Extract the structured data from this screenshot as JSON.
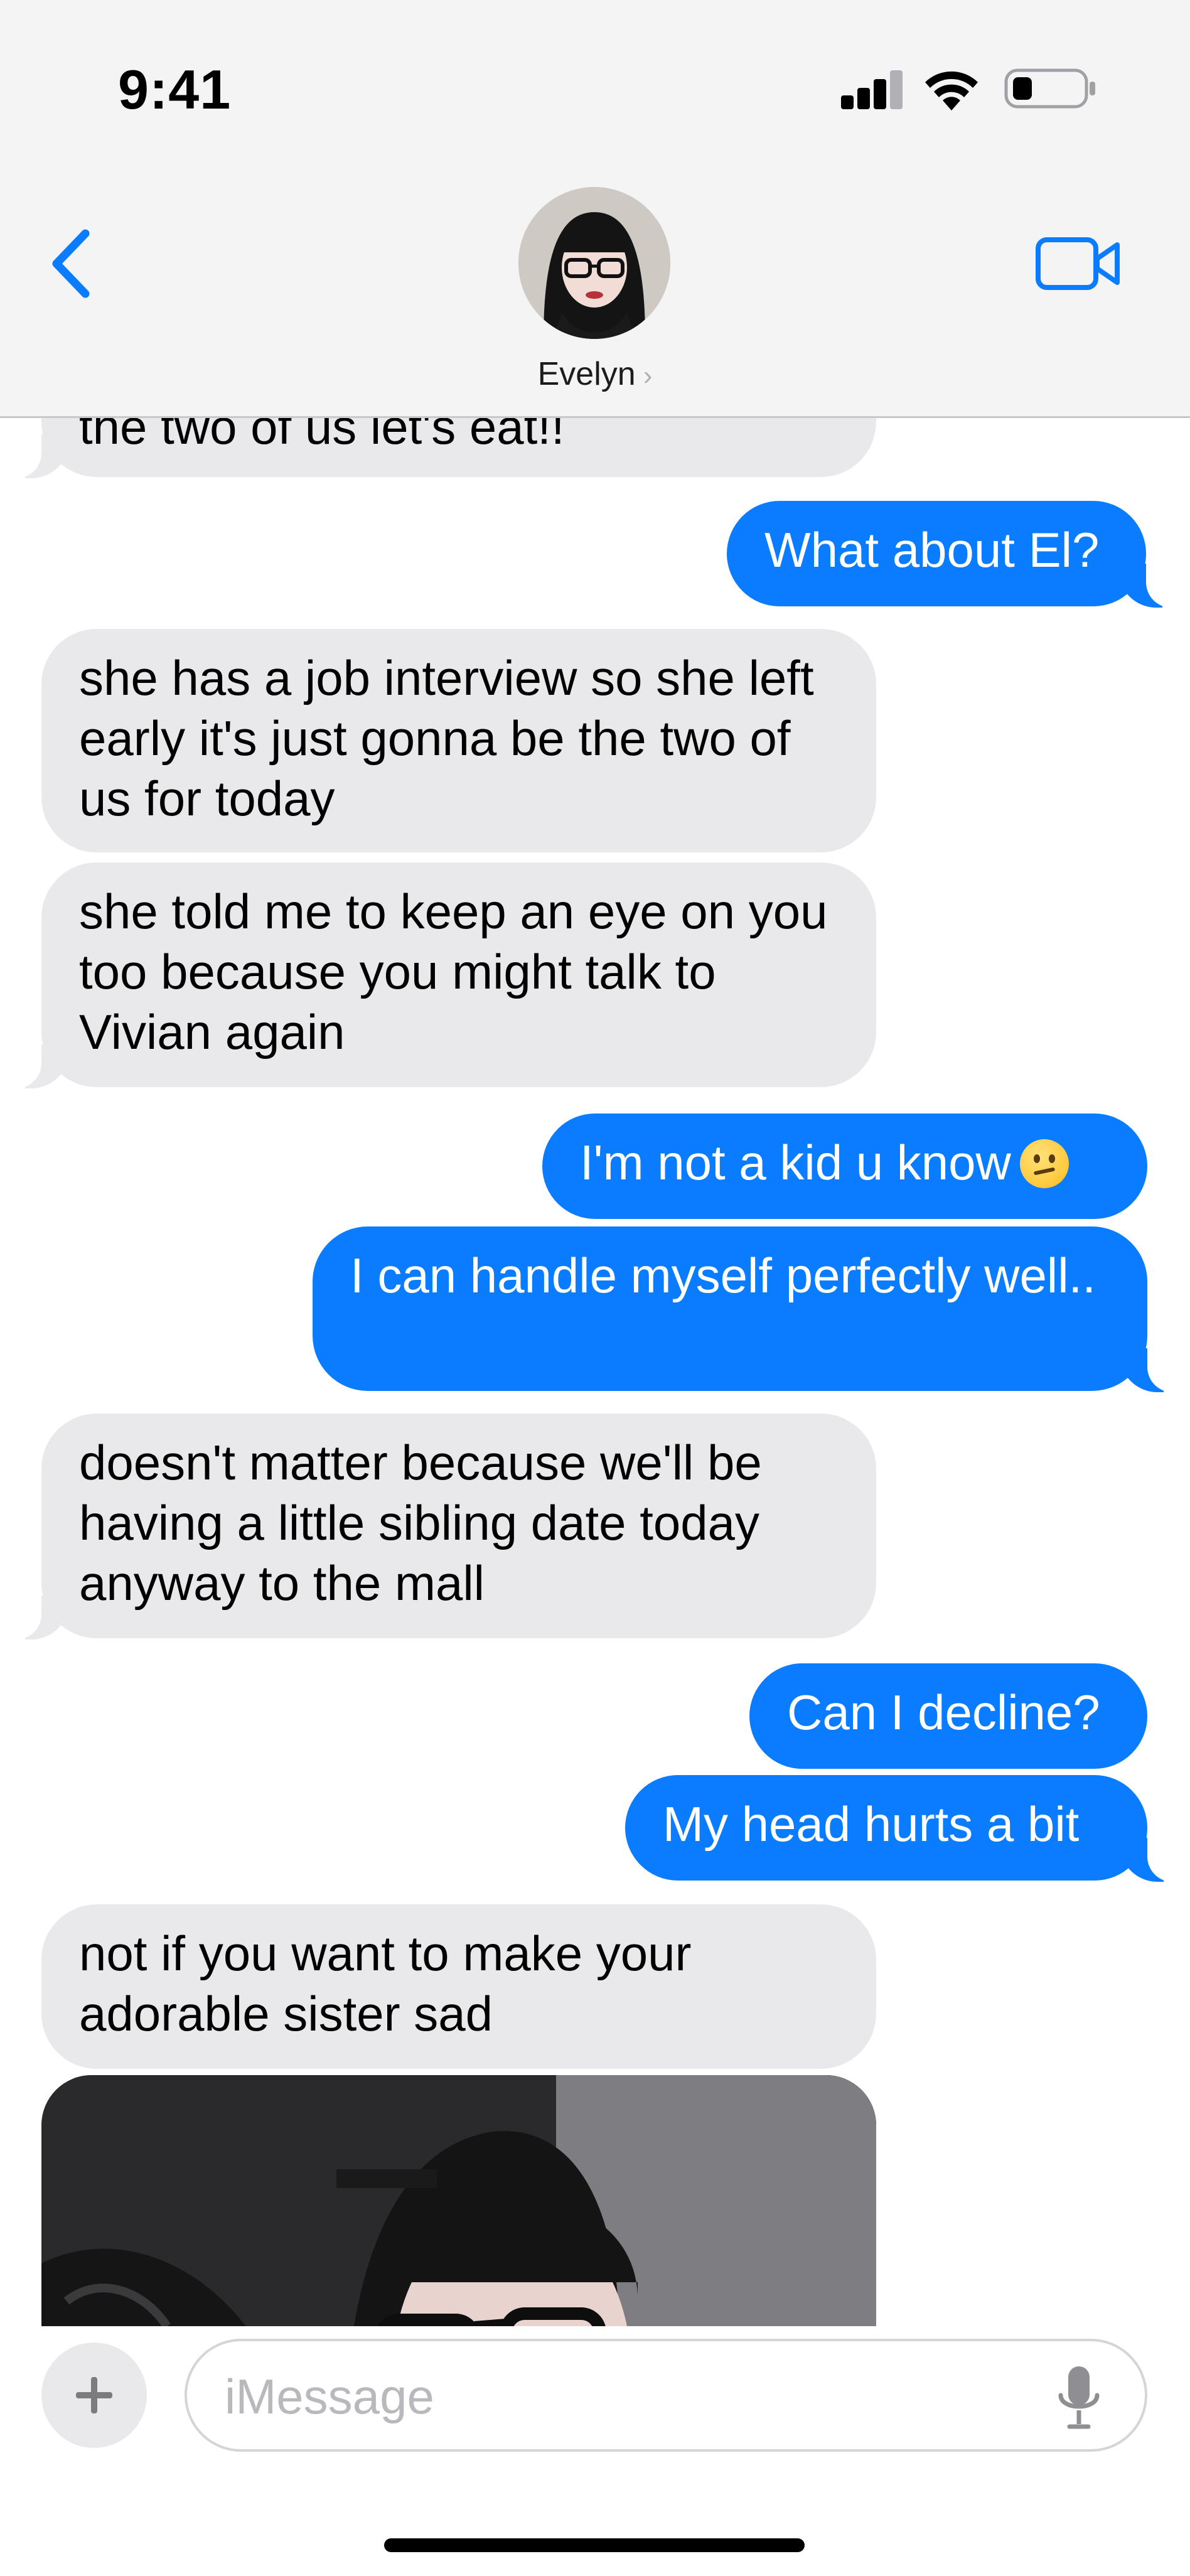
{
  "status_bar": {
    "time": "9:41"
  },
  "header": {
    "contact_name": "Evelyn",
    "chevron": "›"
  },
  "messages": [
    {
      "from": "received",
      "text": "the two of us let's eat!!"
    },
    {
      "from": "sent",
      "text": "What about El?"
    },
    {
      "from": "received",
      "text": "she has a job interview so she left early it's just gonna be the two of us for today"
    },
    {
      "from": "received",
      "text": "she told me to keep an eye on you too because you might talk to Vivian again"
    },
    {
      "from": "sent",
      "text": "I'm not a kid u know",
      "emoji": "confused-face"
    },
    {
      "from": "sent",
      "text": "I can handle myself perfectly well.."
    },
    {
      "from": "received",
      "text": "doesn't matter because we'll be having a little sibling date today anyway to the mall"
    },
    {
      "from": "sent",
      "text": "Can I decline?"
    },
    {
      "from": "sent",
      "text": "My head hurts a bit"
    },
    {
      "from": "received",
      "text": "not if you want to make your adorable sister sad"
    },
    {
      "from": "received",
      "type": "photo"
    }
  ],
  "composer": {
    "placeholder": "iMessage"
  },
  "colors": {
    "sent_bubble": "#0a7cff",
    "received_bubble": "#e9e9eb",
    "accent": "#0a7cff"
  }
}
